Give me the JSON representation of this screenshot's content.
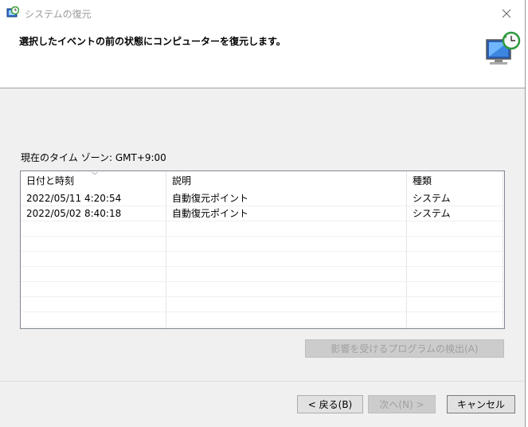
{
  "window": {
    "title": "システムの復元",
    "header_text": "選択したイベントの前の状態にコンピューターを復元します。"
  },
  "timezone_label": "現在のタイム ゾーン: GMT+9:00",
  "table": {
    "columns": [
      "日付と時刻",
      "説明",
      "種類"
    ],
    "rows": [
      {
        "date": "2022/05/11 4:20:54",
        "description": "自動復元ポイント",
        "type": "システム"
      },
      {
        "date": "2022/05/02 8:40:18",
        "description": "自動復元ポイント",
        "type": "システム"
      }
    ]
  },
  "buttons": {
    "scan": "影響を受けるプログラムの検出(A)",
    "back": "< 戻る(B)",
    "next": "次へ(N) >",
    "cancel": "キャンセル"
  },
  "colors": {
    "accent": "#0078d7",
    "disabled_text": "#a0a0a0"
  },
  "icons": {
    "title": "system-restore-icon",
    "header": "monitor-clock-icon",
    "close": "close-icon"
  }
}
